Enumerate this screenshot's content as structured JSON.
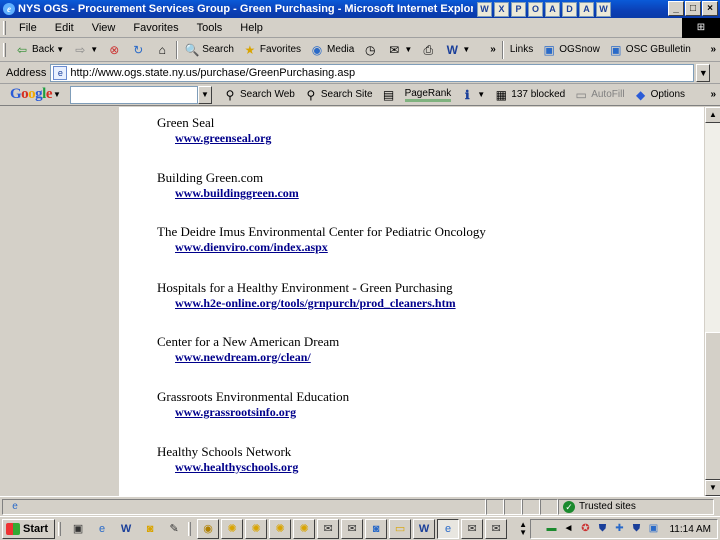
{
  "window": {
    "title": "NYS OGS - Procurement Services Group - Green Purchasing - Microsoft Internet Explorer",
    "tray_icons": [
      "W",
      "X",
      "P",
      "O",
      "A",
      "D",
      "A",
      "W"
    ],
    "min": "_",
    "max": "□",
    "close": "×"
  },
  "menu": [
    "File",
    "Edit",
    "View",
    "Favorites",
    "Tools",
    "Help"
  ],
  "toolbar": {
    "back": "Back",
    "search": "Search",
    "favorites": "Favorites",
    "media": "Media",
    "links": "Links",
    "link1": "OGSnow",
    "link2": "OSC GBulletin",
    "chevron": "»"
  },
  "address": {
    "label": "Address",
    "url": "http://www.ogs.state.ny.us/purchase/GreenPurchasing.asp"
  },
  "google": {
    "logo": "Google",
    "search_web": "Search Web",
    "search_site": "Search Site",
    "pagerank": "PageRank",
    "blocked": "137 blocked",
    "autofill": "AutoFill",
    "options": "Options"
  },
  "resources": [
    {
      "name": "Green Seal",
      "url": "www.greenseal.org"
    },
    {
      "name": "Building Green.com",
      "url": "www.buildinggreen.com"
    },
    {
      "name": "The Deidre Imus Environmental Center for Pediatric Oncology",
      "url": "www.dienviro.com/index.aspx"
    },
    {
      "name": "Hospitals for a Healthy Environment - Green Purchasing",
      "url": "www.h2e-online.org/tools/grnpurch/prod_cleaners.htm"
    },
    {
      "name": "Center for a New American Dream",
      "url": "www.newdream.org/clean/"
    },
    {
      "name": "Grassroots Environmental Education",
      "url": "www.grassrootsinfo.org"
    },
    {
      "name": "Healthy Schools Network",
      "url": "www.healthyschools.org"
    }
  ],
  "status": {
    "zone": "Trusted sites"
  },
  "taskbar": {
    "start": "Start",
    "clock": "11:14 AM"
  }
}
